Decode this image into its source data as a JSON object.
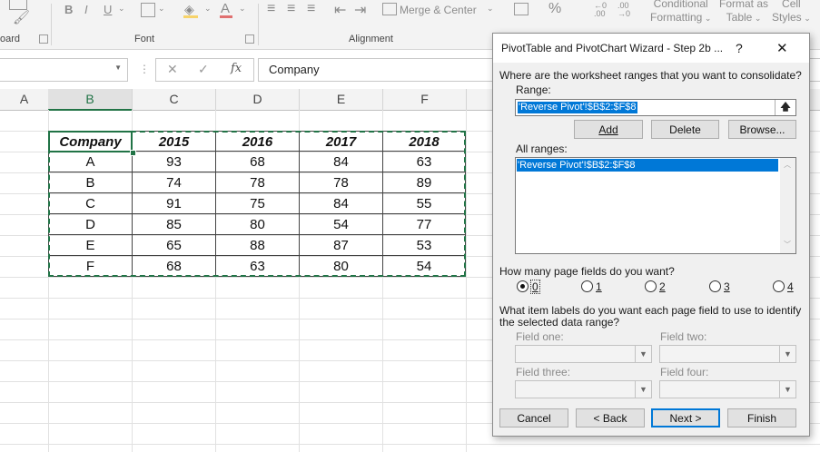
{
  "ribbon": {
    "bold": "B",
    "italic": "I",
    "underline": "U",
    "merge_center": "Merge & Center",
    "conditional1": "Conditional",
    "conditional2": "Formatting",
    "format_as1": "Format as",
    "format_as2": "Table",
    "cell1": "Cell",
    "cell2": "Styles",
    "percent": "%",
    "groups": {
      "clipboard": "oard",
      "font": "Font",
      "alignment": "Alignment"
    }
  },
  "formula_bar": {
    "fx": "fx",
    "content": "Company"
  },
  "columns": [
    "A",
    "B",
    "C",
    "D",
    "E",
    "F"
  ],
  "table": {
    "headers": [
      "Company",
      "2015",
      "2016",
      "2017",
      "2018"
    ],
    "rows": [
      [
        "A",
        "93",
        "68",
        "84",
        "63"
      ],
      [
        "B",
        "74",
        "78",
        "78",
        "89"
      ],
      [
        "C",
        "91",
        "75",
        "84",
        "55"
      ],
      [
        "D",
        "85",
        "80",
        "54",
        "77"
      ],
      [
        "E",
        "65",
        "88",
        "87",
        "53"
      ],
      [
        "F",
        "68",
        "63",
        "80",
        "54"
      ]
    ]
  },
  "dialog": {
    "title": "PivotTable and PivotChart Wizard - Step 2b ...",
    "help": "?",
    "close": "✕",
    "question1": "Where are the worksheet ranges that you want to consolidate?",
    "range_label": "Range:",
    "range_value": "'Reverse Pivot'!$B$2:$F$8",
    "add": "Add",
    "delete": "Delete",
    "browse": "Browse...",
    "all_ranges_label": "All ranges:",
    "all_ranges_items": [
      "'Reverse Pivot'!$B$2:$F$8"
    ],
    "question2": "How many page fields do you want?",
    "page_field_options": [
      "0",
      "1",
      "2",
      "3",
      "4"
    ],
    "selected_page_fields": "0",
    "question3_line1": "What item labels do you want each page field to use to identify",
    "question3_line2": "the selected data range?",
    "field_one": "Field one:",
    "field_two": "Field two:",
    "field_three": "Field three:",
    "field_four": "Field four:",
    "cancel": "Cancel",
    "back": "< Back",
    "next": "Next >",
    "finish": "Finish"
  },
  "colors": {
    "accent": "#217346",
    "dialog_bg": "#f0f0f0",
    "selection": "#0078d7",
    "marching_ants": "#217346"
  }
}
